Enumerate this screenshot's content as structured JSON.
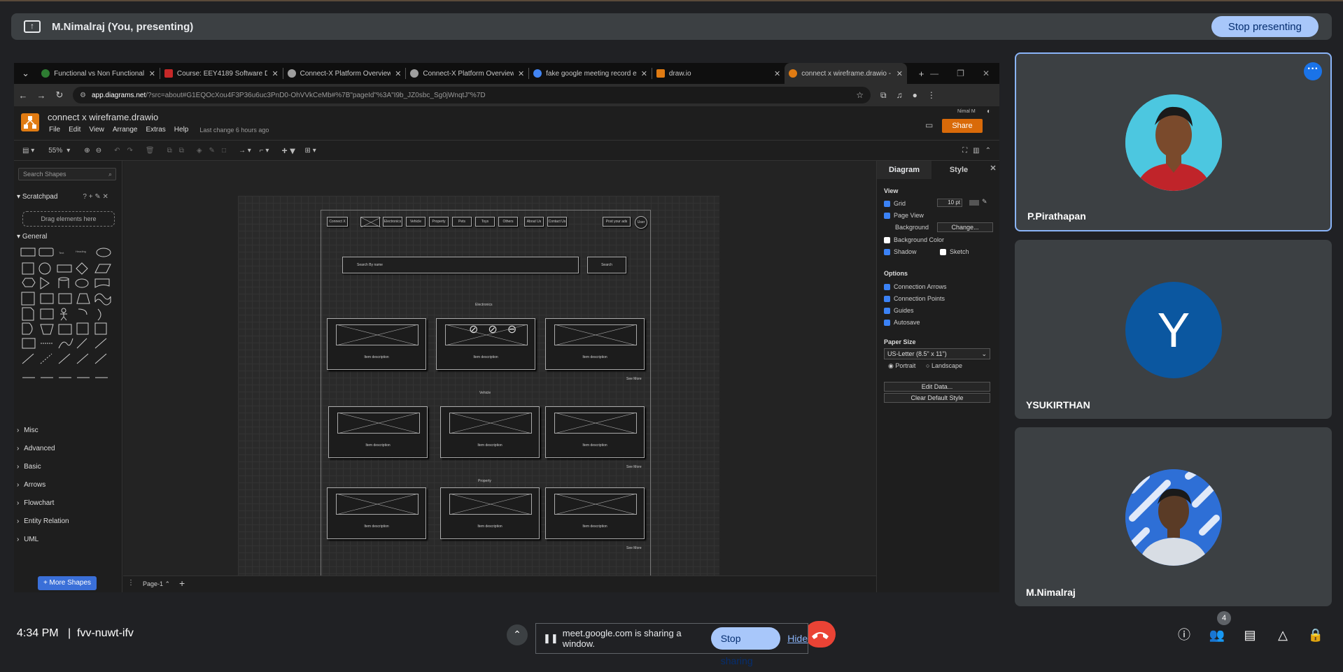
{
  "presenting_bar": {
    "label": "M.Nimalraj (You, presenting)",
    "stop_label": "Stop presenting"
  },
  "browser": {
    "tabs": [
      {
        "title": "Functional vs Non Functional R",
        "color": "#2e7d32"
      },
      {
        "title": "Course: EEY4189 Software Desi",
        "color": "#c62828"
      },
      {
        "title": "Connect-X Platform Overview",
        "color": "#9e9e9e"
      },
      {
        "title": "Connect-X Platform Overview",
        "color": "#9e9e9e"
      },
      {
        "title": "fake google meeting record ex",
        "color": "#4285f4"
      },
      {
        "title": "draw.io",
        "color": "#e07b12"
      },
      {
        "title": "connect x wireframe.drawio - d",
        "color": "#e07b12"
      }
    ],
    "url_host": "app.diagrams.net",
    "url_rest": "/?src=about#G1EQOcXou4F3P36u6uc3PnD0-OhVVkCeMb#%7B\"pageId\"%3A\"I9b_JZ0sbc_Sg0jWnqtJ\"%7D"
  },
  "drawio": {
    "file_title": "connect x wireframe.drawio",
    "menu": [
      "File",
      "Edit",
      "View",
      "Arrange",
      "Extras",
      "Help"
    ],
    "last_change": "Last change 6 hours ago",
    "user": "Nimal M",
    "share_label": "Share",
    "zoom": "55%",
    "search_placeholder": "Search Shapes",
    "scratchpad": "Scratchpad",
    "drag_hint": "Drag elements here",
    "general": "General",
    "sections": [
      "Misc",
      "Advanced",
      "Basic",
      "Arrows",
      "Flowchart",
      "Entity Relation",
      "UML"
    ],
    "more_shapes": "+ More Shapes",
    "page_tab": "Page-1",
    "panel": {
      "tab_diagram": "Diagram",
      "tab_style": "Style",
      "view": "View",
      "grid": "Grid",
      "grid_size": "10 pt",
      "page_view": "Page View",
      "background": "Background",
      "change": "Change...",
      "background_color": "Background Color",
      "shadow": "Shadow",
      "sketch": "Sketch",
      "options": "Options",
      "connection_arrows": "Connection Arrows",
      "connection_points": "Connection Points",
      "guides": "Guides",
      "autosave": "Autosave",
      "paper_size": "Paper Size",
      "paper_value": "US-Letter (8.5\" x 11\")",
      "portrait": "Portrait",
      "landscape": "Landscape",
      "edit_data": "Edit Data...",
      "clear_style": "Clear Default Style"
    },
    "wireframe": {
      "nav": [
        "Connect X",
        "",
        "Electronics",
        "Vehicle",
        "Property",
        "Pets",
        "Toys",
        "Others",
        "About Us",
        "Contact Us"
      ],
      "post_ad": "Post your ads",
      "user": "User",
      "search_ph": "Search By name",
      "search_btn": "Search",
      "sections": [
        "Electronics",
        "Vehicle",
        "Property"
      ],
      "item_desc": "Item description",
      "see_more": "See More"
    }
  },
  "participants": [
    {
      "name": "P.Pirathapan",
      "speaking": true
    },
    {
      "name": "YSUKIRTHAN",
      "initial": "Y",
      "color": "#0b57a0"
    },
    {
      "name": "M.Nimalraj"
    }
  ],
  "bottom": {
    "time": "4:34 PM",
    "code": "fvv-nuwt-ifv",
    "share_msg": "meet.google.com is sharing a window.",
    "stop_sharing": "Stop sharing",
    "hide": "Hide",
    "people_count": "4"
  }
}
